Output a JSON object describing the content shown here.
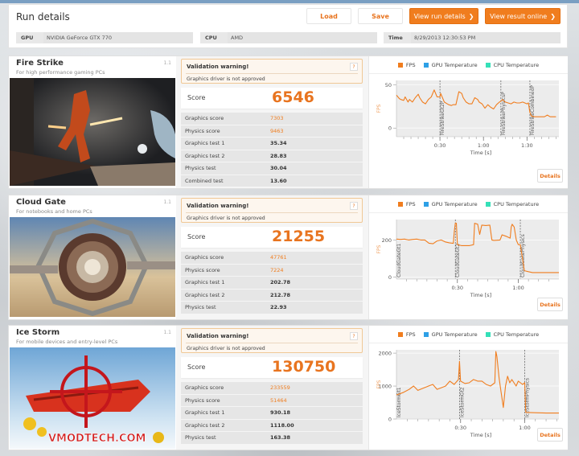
{
  "header": {
    "title": "Run details",
    "buttons": {
      "load": "Load",
      "save": "Save",
      "view_run_details": "View run details",
      "view_result_online": "View result online",
      "chevron": "❯"
    },
    "info": {
      "gpu_label": "GPU",
      "gpu_value": "NVIDIA GeForce GTX 770",
      "cpu_label": "CPU",
      "cpu_value": "AMD",
      "time_label": "Time",
      "time_value": "8/29/2013 12:30:53 PM"
    }
  },
  "common": {
    "warning_title": "Validation warning!",
    "warning_message": "Graphics driver is not approved",
    "warning_help": "?",
    "score_label": "Score",
    "details_label": "Details",
    "legend": [
      {
        "label": "FPS",
        "color": "#f07d1e"
      },
      {
        "label": "GPU Temperature",
        "color": "#2ea0e6"
      },
      {
        "label": "CPU Temperature",
        "color": "#35e0b8"
      }
    ],
    "x_axis_label": "Time [s]",
    "y_axis_label": "FPS",
    "colors": {
      "accent": "#f07d1e",
      "marker": "#555555"
    }
  },
  "tests": [
    {
      "name": "Fire Strike",
      "description": "For high performance gaming PCs",
      "version": "1.1",
      "score": "6546",
      "rows": [
        {
          "label": "Graphics score",
          "value": "7303",
          "highlight": true
        },
        {
          "label": "Physics score",
          "value": "9463",
          "highlight": true
        },
        {
          "label": "Graphics test 1",
          "value": "35.34",
          "highlight": false
        },
        {
          "label": "Graphics test 2",
          "value": "28.83",
          "highlight": false
        },
        {
          "label": "Physics test",
          "value": "30.04",
          "highlight": false
        },
        {
          "label": "Combined test",
          "value": "13.60",
          "highlight": false
        }
      ]
    },
    {
      "name": "Cloud Gate",
      "description": "For notebooks and home PCs",
      "version": "1.1",
      "score": "21255",
      "rows": [
        {
          "label": "Graphics score",
          "value": "47761",
          "highlight": true
        },
        {
          "label": "Physics score",
          "value": "7224",
          "highlight": true
        },
        {
          "label": "Graphics test 1",
          "value": "202.78",
          "highlight": false
        },
        {
          "label": "Graphics test 2",
          "value": "212.78",
          "highlight": false
        },
        {
          "label": "Physics test",
          "value": "22.93",
          "highlight": false
        }
      ]
    },
    {
      "name": "Ice Storm",
      "description": "For mobile devices and entry-level PCs",
      "version": "1.1",
      "score": "130750",
      "rows": [
        {
          "label": "Graphics score",
          "value": "233559",
          "highlight": true
        },
        {
          "label": "Physics score",
          "value": "51464",
          "highlight": true
        },
        {
          "label": "Graphics test 1",
          "value": "930.18",
          "highlight": false
        },
        {
          "label": "Graphics test 2",
          "value": "1118.00",
          "highlight": false
        },
        {
          "label": "Physics test",
          "value": "163.38",
          "highlight": false
        }
      ],
      "watermark": "VMODTECH.COM"
    }
  ],
  "chart_data": [
    {
      "type": "line",
      "title": "Fire Strike",
      "xlabel": "Time [s]",
      "ylabel": "FPS",
      "xlim": [
        0,
        112
      ],
      "ylim": [
        -10,
        55
      ],
      "yticks": [
        0,
        50
      ],
      "xticks": [
        30,
        60,
        90
      ],
      "xtick_labels": [
        "0:30",
        "1:00",
        "1:30"
      ],
      "markers": [
        {
          "x": 30,
          "label": "FireStrikeGt2P"
        },
        {
          "x": 72,
          "label": "FireStrikePhysicsP"
        },
        {
          "x": 92,
          "label": "FireStrikeCombinedP"
        }
      ],
      "series": [
        {
          "name": "FPS",
          "x": [
            0,
            2,
            3,
            5,
            6,
            8,
            9,
            11,
            13,
            15,
            16,
            18,
            20,
            22,
            24,
            26,
            28,
            30,
            30.5,
            33,
            36,
            38,
            39,
            41,
            43,
            45,
            46,
            48,
            50,
            52,
            54,
            56,
            57,
            59,
            61,
            63,
            65,
            67,
            69,
            71,
            72,
            73,
            75,
            77,
            79,
            81,
            83,
            85,
            87,
            90,
            91,
            92,
            93,
            95,
            98,
            100,
            102,
            104,
            106,
            108,
            110
          ],
          "y": [
            38,
            34,
            33,
            32,
            36,
            30,
            33,
            30,
            35,
            39,
            35,
            30,
            28,
            33,
            36,
            44,
            36,
            36,
            40,
            30,
            27,
            26,
            27,
            27,
            42,
            40,
            35,
            30,
            28,
            28,
            35,
            33,
            30,
            28,
            23,
            27,
            24,
            22,
            27,
            30,
            31,
            33,
            30,
            29,
            28,
            30,
            29,
            29,
            30,
            28,
            29,
            18,
            14,
            13,
            13,
            13,
            13,
            15,
            13,
            13,
            13
          ]
        }
      ]
    },
    {
      "type": "line",
      "title": "Cloud Gate",
      "xlabel": "Time [s]",
      "ylabel": "FPS",
      "xlim": [
        0,
        80
      ],
      "ylim": [
        -10,
        310
      ],
      "yticks": [
        0,
        200
      ],
      "xticks": [
        30,
        60
      ],
      "xtick_labels": [
        "0:30",
        "1:00"
      ],
      "markers": [
        {
          "x": 0,
          "label": "CloudGateGt1"
        },
        {
          "x": 29,
          "label": "CloudGateGt2"
        },
        {
          "x": 61,
          "label": "CloudGatePhysics"
        }
      ],
      "series": [
        {
          "name": "FPS",
          "x": [
            0,
            2,
            4,
            6,
            8,
            10,
            12,
            14,
            16,
            18,
            20,
            22,
            24,
            26,
            28,
            28.5,
            29,
            29.5,
            30,
            32,
            36,
            38,
            38.5,
            40,
            41,
            42,
            44,
            46,
            47,
            48,
            51,
            52,
            54,
            56,
            56.5,
            57,
            58,
            59,
            60,
            61,
            63,
            65,
            67,
            70,
            75,
            80
          ],
          "y": [
            205,
            203,
            205,
            200,
            203,
            205,
            200,
            200,
            183,
            180,
            195,
            200,
            190,
            185,
            182,
            250,
            290,
            290,
            175,
            170,
            170,
            175,
            290,
            285,
            230,
            280,
            278,
            280,
            200,
            198,
            200,
            228,
            220,
            210,
            270,
            285,
            270,
            200,
            175,
            175,
            35,
            30,
            25,
            25,
            25,
            25
          ]
        }
      ]
    },
    {
      "type": "line",
      "title": "Ice Storm",
      "xlabel": "Time [s]",
      "ylabel": "FPS",
      "xlim": [
        0,
        76
      ],
      "ylim": [
        0,
        2100
      ],
      "yticks": [
        0,
        1000,
        2000
      ],
      "xticks": [
        30,
        60
      ],
      "xtick_labels": [
        "0:30",
        "1:00"
      ],
      "markers": [
        {
          "x": 0,
          "label": "IceStormGt1"
        },
        {
          "x": 29.5,
          "label": "IceStormGt2"
        },
        {
          "x": 60,
          "label": "IceStormPhysics"
        }
      ],
      "series": [
        {
          "name": "FPS",
          "x": [
            0,
            3,
            6,
            8,
            10,
            13,
            15,
            17,
            19,
            21,
            23,
            25,
            27,
            29,
            29.5,
            30,
            32,
            34,
            36,
            38,
            40,
            42,
            44,
            46,
            46.5,
            47,
            48,
            49,
            50,
            51,
            52,
            53,
            54,
            55,
            56,
            57,
            58,
            59,
            60,
            60.5,
            65,
            70,
            76
          ],
          "y": [
            730,
            800,
            900,
            1000,
            870,
            950,
            1000,
            1050,
            900,
            950,
            1000,
            1150,
            1050,
            1200,
            1750,
            1150,
            1080,
            1100,
            1200,
            1150,
            1150,
            1050,
            1000,
            1100,
            2050,
            1900,
            1250,
            800,
            350,
            1000,
            1300,
            1100,
            1200,
            1100,
            1000,
            1150,
            1100,
            1050,
            1100,
            200,
            190,
            180,
            180
          ]
        }
      ]
    }
  ]
}
